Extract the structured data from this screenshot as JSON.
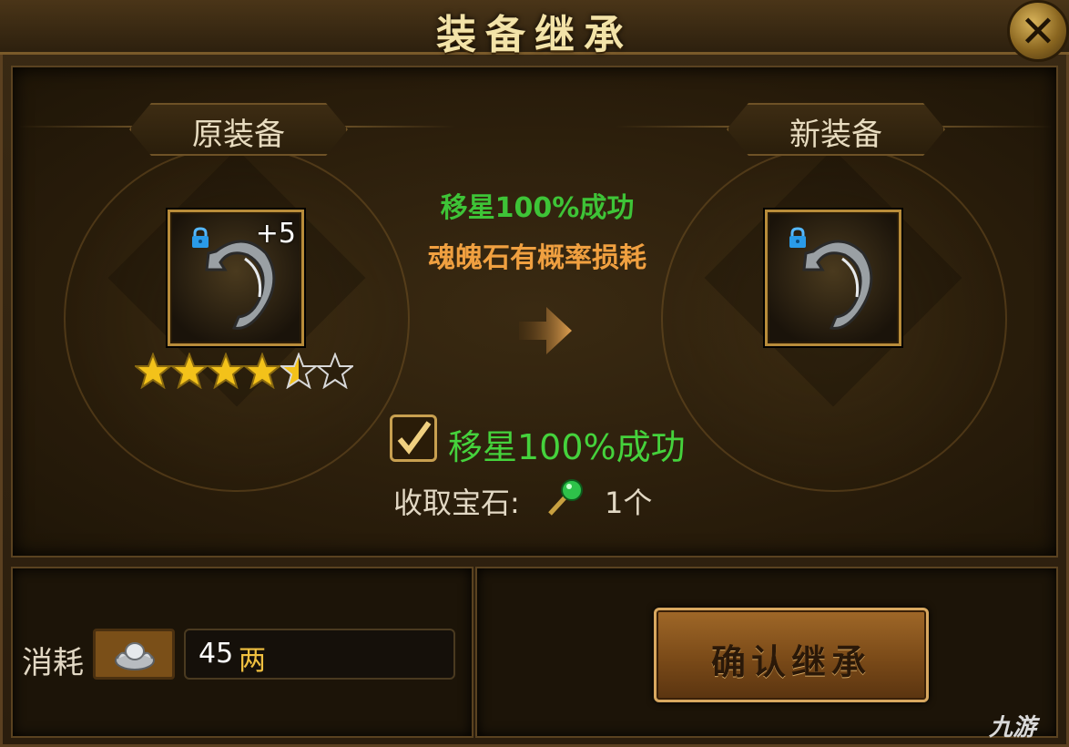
{
  "window": {
    "title": "装备继承",
    "close_icon": "close-icon"
  },
  "original": {
    "banner": "原装备",
    "level": "+5",
    "stars_filled": 4.5,
    "stars_total": 6
  },
  "target": {
    "banner": "新装备"
  },
  "info": {
    "success_line": "移星100%成功",
    "loss_line": "魂魄石有概率损耗"
  },
  "option": {
    "checked": true,
    "label": "移星100%成功",
    "gem_label": "收取宝石:",
    "gem_count": "1个"
  },
  "cost": {
    "label": "消耗",
    "currency_icon": "silver-ingot-icon",
    "amount": "45",
    "unit": "两"
  },
  "confirm": {
    "label": "确认继承"
  },
  "watermark": {
    "text": "九游"
  },
  "colors": {
    "green": "#3ec437",
    "orange": "#f0a040",
    "gold": "#b88c3a"
  }
}
